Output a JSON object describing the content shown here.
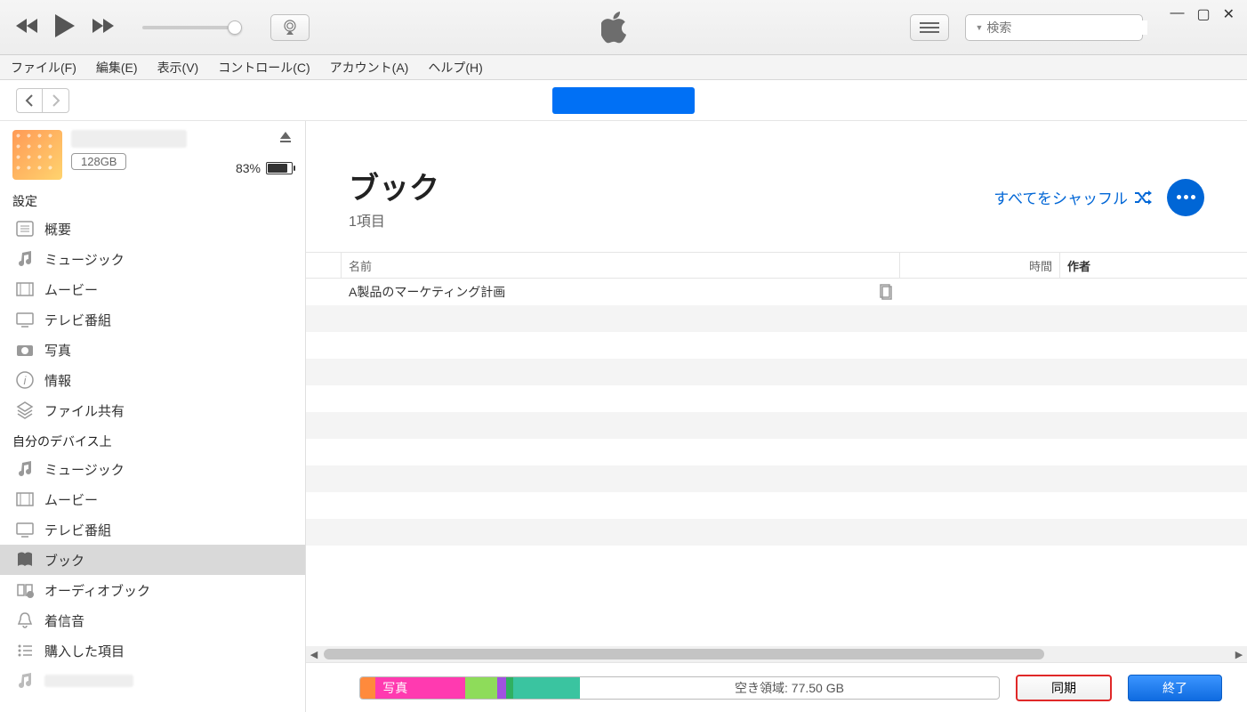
{
  "search": {
    "placeholder": "検索"
  },
  "menu": {
    "file": "ファイル(F)",
    "edit": "編集(E)",
    "view": "表示(V)",
    "control": "コントロール(C)",
    "account": "アカウント(A)",
    "help": "ヘルプ(H)"
  },
  "device": {
    "storage_badge": "128GB",
    "battery_percent": "83%"
  },
  "sidebar": {
    "section_settings": "設定",
    "section_on_device": "自分のデバイス上",
    "settings_items": [
      {
        "label": "概要"
      },
      {
        "label": "ミュージック"
      },
      {
        "label": "ムービー"
      },
      {
        "label": "テレビ番組"
      },
      {
        "label": "写真"
      },
      {
        "label": "情報"
      },
      {
        "label": "ファイル共有"
      }
    ],
    "device_items": [
      {
        "label": "ミュージック"
      },
      {
        "label": "ムービー"
      },
      {
        "label": "テレビ番組"
      },
      {
        "label": "ブック",
        "selected": true
      },
      {
        "label": "オーディオブック"
      },
      {
        "label": "着信音"
      },
      {
        "label": "購入した項目"
      },
      {
        "label": ""
      }
    ]
  },
  "content": {
    "title": "ブック",
    "subtitle": "1項目",
    "shuffle_label": "すべてをシャッフル",
    "cols": {
      "name": "名前",
      "time": "時間",
      "author": "作者"
    },
    "rows": [
      {
        "name": "A製品のマーケティング計画"
      }
    ]
  },
  "footer": {
    "photos_label": "写真",
    "free_label": "空き領域: 77.50 GB",
    "sync_label": "同期",
    "done_label": "終了"
  }
}
